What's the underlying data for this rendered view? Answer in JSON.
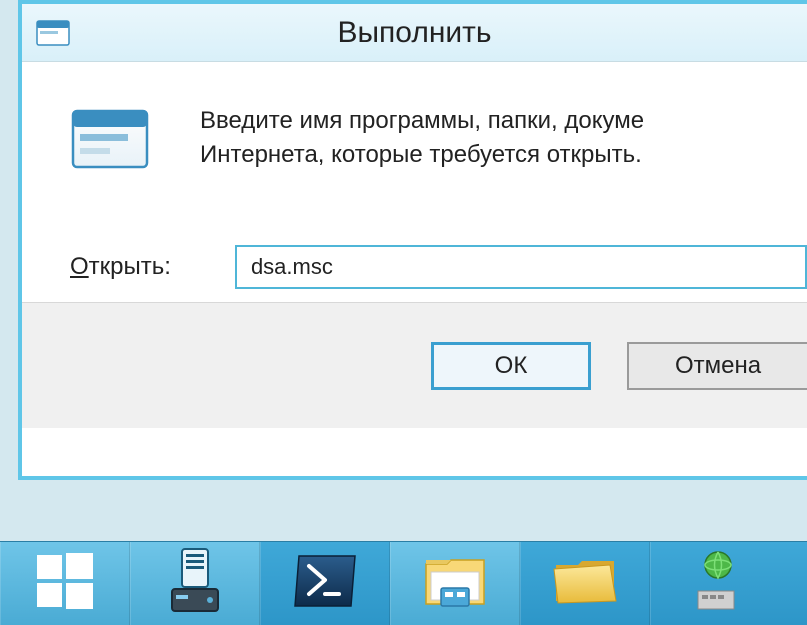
{
  "dialog": {
    "title": "Выполнить",
    "description": "Введите имя программы, папки, докуме\nИнтернета, которые требуется открыть.",
    "label_prefix": "О",
    "label_rest": "ткрыть:",
    "input_value": "dsa.msc",
    "buttons": {
      "ok": "ОК",
      "cancel": "Отмена"
    }
  },
  "taskbar": {
    "items": [
      {
        "name": "start",
        "icon": "windows-logo"
      },
      {
        "name": "server-manager",
        "icon": "server"
      },
      {
        "name": "powershell",
        "icon": "powershell"
      },
      {
        "name": "explorer",
        "icon": "file-explorer"
      },
      {
        "name": "folder",
        "icon": "folder"
      },
      {
        "name": "network",
        "icon": "globe"
      }
    ]
  }
}
